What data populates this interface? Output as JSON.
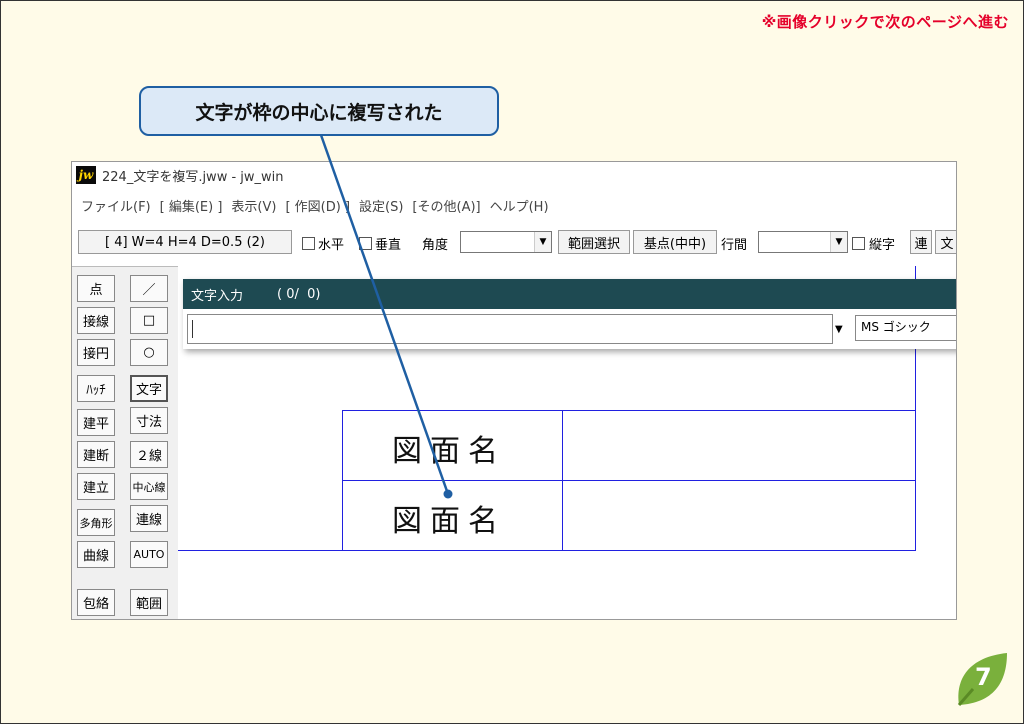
{
  "slide": {
    "hint": "※画像クリックで次のページへ進む",
    "callout": "文字が枠の中心に複写された",
    "page_number": "7",
    "accent_color": "#e5002a",
    "callout_border_color": "#1f5fa3",
    "leaf_color": "#7ab03c"
  },
  "window": {
    "app_icon": "jw",
    "title": "224_文字を複写.jww - jw_win",
    "menu": [
      "ファイル(F)",
      "[ 編集(E) ]",
      "表示(V)",
      "[ 作図(D) ]",
      "設定(S)",
      "[その他(A)]",
      "ヘルプ(H)"
    ]
  },
  "toolbar": {
    "size_button": "[ 4]  W=4  H=4  D=0.5 (2)",
    "horizontal_label": "水平",
    "vertical_label": "垂直",
    "angle_label": "角度",
    "range_select": "範囲選択",
    "base_point": "基点(中中)",
    "line_spacing_label": "行間",
    "vertical_text_label": "縦字",
    "ren_button": "連",
    "bun_button": "文"
  },
  "tools": {
    "left": [
      "点",
      "接線",
      "接円",
      "ﾊｯﾁ",
      "建平",
      "建断",
      "建立",
      "多角形",
      "曲線",
      "包絡"
    ],
    "right": [
      "／",
      "□",
      "○",
      "文字",
      "寸法",
      "２線",
      "中心線",
      "連線",
      "AUTO",
      "範囲"
    ]
  },
  "dialog": {
    "title": "文字入力",
    "counter": "( 0/  0)",
    "font": "MS ゴシック"
  },
  "drawing": {
    "cells": [
      "図面名",
      "図面名"
    ]
  }
}
